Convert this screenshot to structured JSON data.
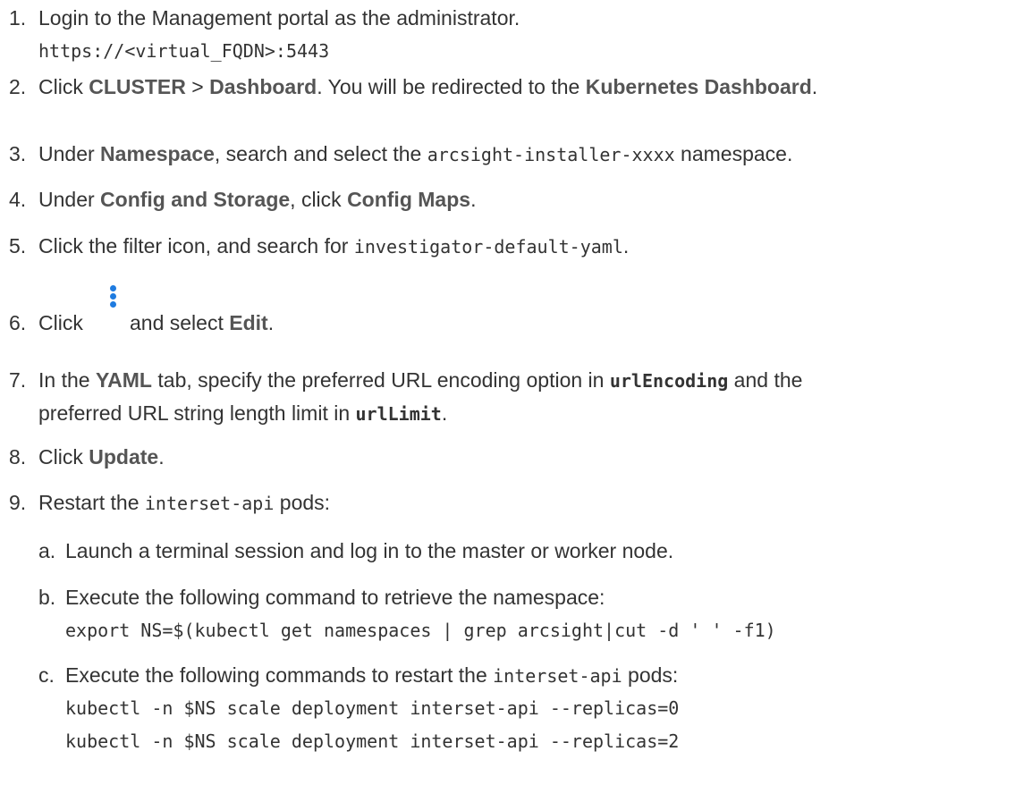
{
  "steps": {
    "s1": {
      "num": "1.",
      "text": "Login to the Management portal as the administrator.",
      "url": "https://<virtual_FQDN>:5443"
    },
    "s2": {
      "num": "2.",
      "pre": "Click ",
      "ui1": "CLUSTER",
      "sep": " > ",
      "ui2": "Dashboard",
      "mid": ". You will be redirected to the ",
      "ui3": "Kubernetes Dashboard",
      "post": "."
    },
    "s3": {
      "num": "3.",
      "pre": "Under ",
      "ui1": "Namespace",
      "mid": ", search and select the ",
      "code": "arcsight-installer-xxxx",
      "post": " namespace."
    },
    "s4": {
      "num": "4.",
      "pre": "Under ",
      "ui1": "Config and Storage",
      "mid": ", click ",
      "ui2": "Config Maps",
      "post": "."
    },
    "s5": {
      "num": "5.",
      "pre": "Click the filter icon, and search for ",
      "code": "investigator-default-yaml",
      "post": "."
    },
    "s6": {
      "num": "6.",
      "pre": "Click",
      "mid": "and select ",
      "ui1": "Edit",
      "post": "."
    },
    "s7": {
      "num": "7.",
      "pre": "In the ",
      "ui1": "YAML",
      "mid": " tab, specify the preferred URL encoding option in ",
      "code1": "urlEncoding",
      "mid2": " and the",
      "line2pre": "preferred URL string length limit in ",
      "code2": "urlLimit",
      "post": "."
    },
    "s8": {
      "num": "8.",
      "pre": "Click ",
      "ui1": "Update",
      "post": "."
    },
    "s9": {
      "num": "9.",
      "pre": "Restart the ",
      "code": "interset-api",
      "post": " pods:",
      "a": {
        "letter": "a.",
        "text": "Launch a terminal session and log in to the master or worker node."
      },
      "b": {
        "letter": "b.",
        "text": "Execute the following command to retrieve the namespace:",
        "cmd": "export NS=$(kubectl get namespaces | grep arcsight|cut -d ' ' -f1)"
      },
      "c": {
        "letter": "c.",
        "pre": "Execute the following commands to restart the ",
        "code": "interset-api",
        "post": " pods:",
        "cmd1": "kubectl -n $NS scale deployment interset-api --replicas=0",
        "cmd2": "kubectl -n $NS scale deployment interset-api --replicas=2"
      }
    }
  }
}
